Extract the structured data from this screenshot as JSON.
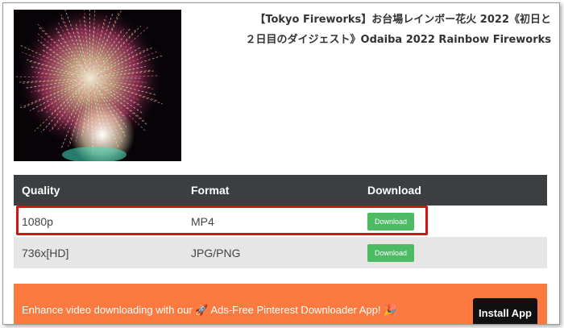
{
  "video": {
    "title": "【Tokyo Fireworks】お台場レインボー花火 2022《初日と２日目のダイジェスト》Odaiba 2022 Rainbow Fireworks",
    "thumbnail_icon": "fireworks-image"
  },
  "table": {
    "headers": [
      "Quality",
      "Format",
      "Download"
    ],
    "rows": [
      {
        "quality": "1080p",
        "format": "MP4",
        "button": "Download"
      },
      {
        "quality": "736x[HD]",
        "format": "JPG/PNG",
        "button": "Download"
      }
    ]
  },
  "banner": {
    "text": "Enhance video downloading with our 🚀 Ads-Free Pinterest Downloader App! 🎉",
    "button": "Install App"
  },
  "colors": {
    "table_header": "#3c3f41",
    "download_button": "#4cbb63",
    "highlight": "#d01414",
    "banner": "#fc7a40"
  }
}
